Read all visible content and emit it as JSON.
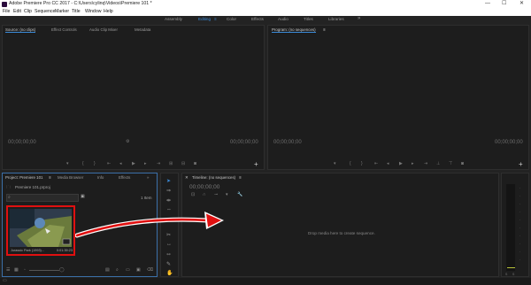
{
  "window": {
    "title": "Adobe Premiere Pro CC 2017 - C:\\Users\\cylinq\\Videos\\Premiere 101 *",
    "min_icon": "—",
    "max_icon": "☐",
    "close_icon": "✕"
  },
  "menu": [
    "File",
    "Edit",
    "Clip",
    "Sequence",
    "Marker",
    "Title",
    "Window",
    "Help"
  ],
  "workspaces": {
    "items": [
      "Assembly",
      "Editing",
      "Color",
      "Effects",
      "Audio",
      "Titles",
      "Libraries"
    ],
    "active": "Editing",
    "more": "»"
  },
  "source_monitor": {
    "tabs": [
      "Source: (no clips)",
      "Effect Controls",
      "Audio Clip Mixer",
      "Metadata"
    ],
    "timecode_left": "00;00;00;00",
    "timecode_right": "00;00;00;00"
  },
  "program_monitor": {
    "tab": "Program: (no sequences)",
    "timecode_left": "00;00;00;00",
    "timecode_right": "00;00;00;00"
  },
  "project_panel": {
    "tabs": [
      "Project: Premiere 101",
      "Media Browser",
      "Info",
      "Effects"
    ],
    "file_name": "Premiere 101.prproj",
    "item_count": "1 Item",
    "clip": {
      "name": "Jurassic Park (1993)...",
      "duration": "0:01:39:23"
    }
  },
  "timeline": {
    "tab": "Timeline: (no sequences)",
    "timecode": "00;00;00;00",
    "empty_message": "Drop media here to create sequence."
  },
  "colors": {
    "accent": "#3b8bd9",
    "highlight_border": "#e01010",
    "arrow": "#e01010"
  }
}
